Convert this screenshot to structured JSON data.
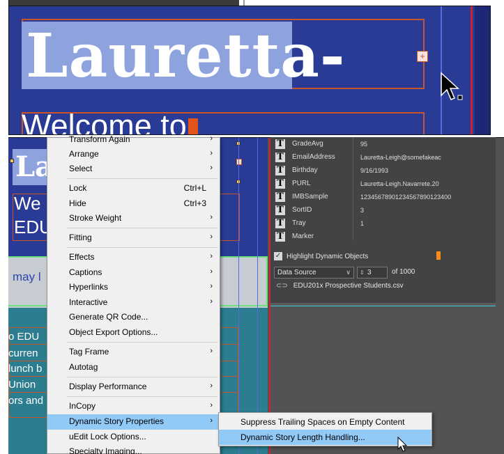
{
  "top_panel": {
    "headline": "Lauretta-",
    "subhead": "Welcome to"
  },
  "canvas": {
    "la": "La",
    "we1": "We",
    "we2": "EDU",
    "may": "may l",
    "teal_lines": [
      "o EDU",
      "curren",
      "lunch b",
      "Union",
      "ors and"
    ]
  },
  "data_merge": {
    "fields": [
      {
        "name": "GradeAvg",
        "value": "95"
      },
      {
        "name": "EmailAddress",
        "value": "Lauretta-Leigh@somefakeac"
      },
      {
        "name": "Birthday",
        "value": "9/16/1993"
      },
      {
        "name": "PURL",
        "value": "Lauretta-Leigh.Navarrete.20"
      },
      {
        "name": "IMBSample",
        "value": "12345678901234567890123400"
      },
      {
        "name": "SortID",
        "value": "3"
      },
      {
        "name": "Tray",
        "value": "1"
      },
      {
        "name": "Marker",
        "value": ""
      }
    ],
    "highlight_label": "Highlight Dynamic Objects",
    "data_source_label": "Data Source",
    "record_value": "3",
    "record_total": "of 1000",
    "csv_file": "EDU201x Prospective Students.csv"
  },
  "context_menu": {
    "items": [
      {
        "label": "Transform Again",
        "shortcut": "",
        "submenu": true
      },
      {
        "label": "Arrange",
        "shortcut": "",
        "submenu": true
      },
      {
        "label": "Select",
        "shortcut": "",
        "submenu": true
      },
      {
        "label": "Lock",
        "shortcut": "Ctrl+L",
        "submenu": false
      },
      {
        "label": "Hide",
        "shortcut": "Ctrl+3",
        "submenu": false
      },
      {
        "label": "Stroke Weight",
        "shortcut": "",
        "submenu": true
      },
      {
        "label": "Fitting",
        "shortcut": "",
        "submenu": true
      },
      {
        "label": "Effects",
        "shortcut": "",
        "submenu": true
      },
      {
        "label": "Captions",
        "shortcut": "",
        "submenu": true
      },
      {
        "label": "Hyperlinks",
        "shortcut": "",
        "submenu": true
      },
      {
        "label": "Interactive",
        "shortcut": "",
        "submenu": true
      },
      {
        "label": "Generate QR Code...",
        "shortcut": "",
        "submenu": false
      },
      {
        "label": "Object Export Options...",
        "shortcut": "",
        "submenu": false
      },
      {
        "label": "Tag Frame",
        "shortcut": "",
        "submenu": true
      },
      {
        "label": "Autotag",
        "shortcut": "",
        "submenu": false
      },
      {
        "label": "Display Performance",
        "shortcut": "",
        "submenu": true
      },
      {
        "label": "InCopy",
        "shortcut": "",
        "submenu": true
      },
      {
        "label": "Dynamic Story Properties",
        "shortcut": "",
        "submenu": true
      },
      {
        "label": "uEdit Lock Options...",
        "shortcut": "",
        "submenu": false
      },
      {
        "label": "Specialty Imaging...",
        "shortcut": "",
        "submenu": false
      }
    ]
  },
  "submenu": {
    "items": [
      {
        "label": "Suppress Trailing Spaces on Empty Content"
      },
      {
        "label": "Dynamic Story Length Handling..."
      }
    ]
  },
  "icons": {
    "arrow": "chevron-right-icon",
    "text_field": "text-field-icon",
    "checkbox": "checkbox-checked-icon",
    "link": "link-icon"
  },
  "colors": {
    "canvas_blue": "#2a3b95",
    "selection": "#8ea3de",
    "frame_orange": "#c8562a",
    "menu_highlight": "#91c9f7"
  }
}
